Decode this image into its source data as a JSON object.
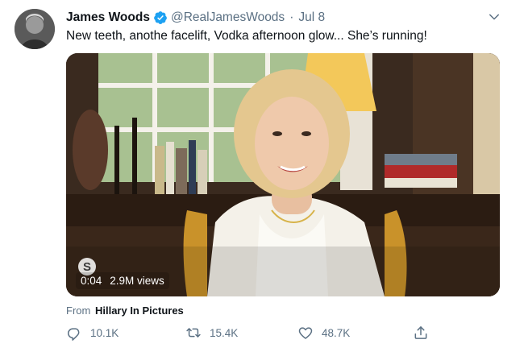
{
  "author": {
    "name": "James Woods",
    "handle": "@RealJamesWoods",
    "separator": "·",
    "date": "Jul 8",
    "verified": true
  },
  "tweet": {
    "text": "New teeth, anothe facelift, Vodka afternoon glow... She’s running!"
  },
  "video": {
    "duration": "0:04",
    "views": "2.9M views",
    "badge_icon": "skype-logo-icon"
  },
  "source": {
    "prefix": "From",
    "account": "Hillary In Pictures"
  },
  "actions": {
    "replies": "10.1K",
    "retweets": "15.4K",
    "likes": "48.7K"
  },
  "colors": {
    "secondary_text": "#5b7083",
    "verified_blue": "#1da1f2",
    "text": "#0f1419"
  }
}
